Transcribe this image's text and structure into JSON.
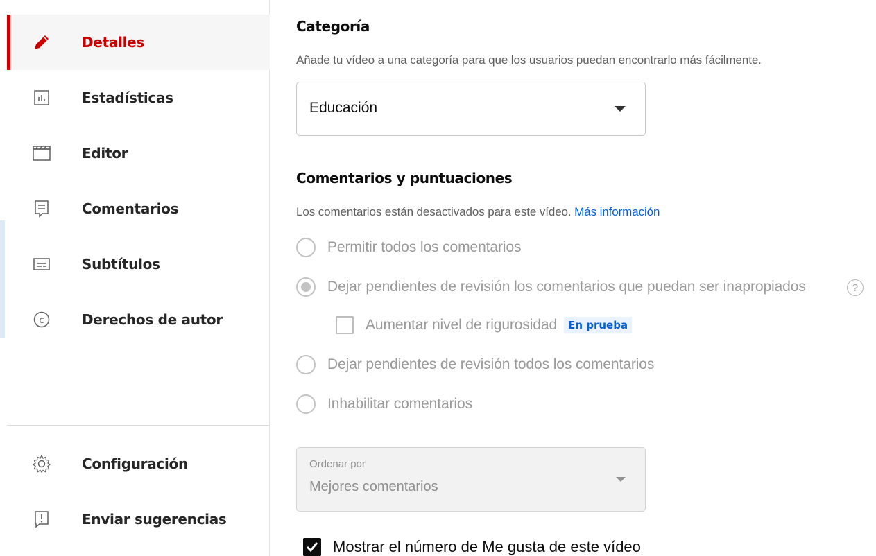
{
  "sidebar": {
    "items": [
      {
        "label": "Detalles",
        "icon": "pencil-icon",
        "active": true
      },
      {
        "label": "Estadísticas",
        "icon": "analytics-icon"
      },
      {
        "label": "Editor",
        "icon": "clapper-icon"
      },
      {
        "label": "Comentarios",
        "icon": "comment-icon"
      },
      {
        "label": "Subtítulos",
        "icon": "subtitles-icon"
      },
      {
        "label": "Derechos de autor",
        "icon": "copyright-icon"
      }
    ],
    "bottom_items": [
      {
        "label": "Configuración",
        "icon": "gear-icon"
      },
      {
        "label": "Enviar sugerencias",
        "icon": "feedback-icon"
      }
    ],
    "accent_color": "#cc0000"
  },
  "category": {
    "title": "Categoría",
    "description": "Añade tu vídeo a una categoría para que los usuarios puedan encontrarlo más fácilmente.",
    "selected": "Educación"
  },
  "comments": {
    "title": "Comentarios y puntuaciones",
    "description": "Los comentarios están desactivados para este vídeo.",
    "link": "Más información",
    "options": [
      {
        "label": "Permitir todos los comentarios",
        "checked": false
      },
      {
        "label": "Dejar pendientes de revisión los comentarios que puedan ser inapropiados",
        "checked": true
      },
      {
        "label": "Dejar pendientes de revisión todos los comentarios",
        "checked": false
      },
      {
        "label": "Inhabilitar comentarios",
        "checked": false
      }
    ],
    "help_glyph": "?",
    "strict": {
      "label": "Aumentar nivel de rigurosidad",
      "badge": "En prueba",
      "checked": false
    },
    "sort": {
      "label": "Ordenar por",
      "value": "Mejores comentarios"
    },
    "show_likes": {
      "label": "Mostrar el número de Me gusta de este vídeo",
      "checked": true
    }
  },
  "colors": {
    "link": "#065fd4",
    "active": "#cc0000"
  }
}
